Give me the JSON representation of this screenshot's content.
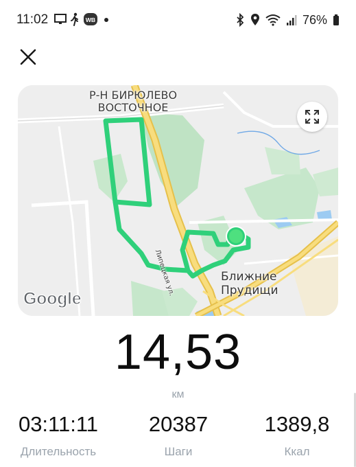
{
  "status_bar": {
    "time": "11:02",
    "battery": "76%",
    "left_icons": [
      "monitor-icon",
      "walking-icon",
      "wb-app-icon",
      "dot-icon"
    ],
    "right_icons": [
      "bluetooth-icon",
      "location-icon",
      "wifi-icon",
      "signal-icon",
      "battery-icon"
    ],
    "wb_badge": "WB"
  },
  "header": {
    "close_icon": "close-icon"
  },
  "map": {
    "district_label": "Р-Н БИРЮЛЕВО\nВОСТОЧНОЕ",
    "street_label": "Липецкая ул.",
    "place_label": "Ближние\nПрудищи",
    "attribution": "Google",
    "expand_icon": "expand-icon",
    "route_color": "#2fd07a",
    "marker_color": "#3fd26e"
  },
  "workout": {
    "distance": "14,53",
    "distance_unit": "км",
    "stats": [
      {
        "value": "03:11:11",
        "label": "Длительность"
      },
      {
        "value": "20387",
        "label": "Шаги"
      },
      {
        "value": "1389,8",
        "label": "Ккал"
      }
    ]
  }
}
